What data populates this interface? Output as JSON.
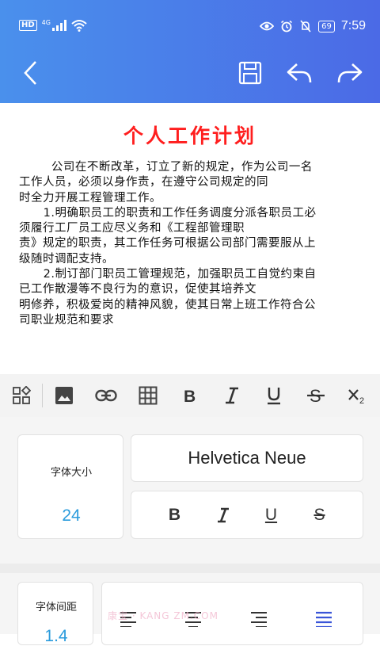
{
  "status_bar": {
    "network_badge": "HD",
    "network_type": "4G",
    "battery": "69",
    "time": "7:59"
  },
  "header": {
    "icons": [
      "back-icon",
      "save-icon",
      "undo-icon",
      "redo-icon"
    ]
  },
  "document": {
    "title": "个人工作计划",
    "title_color": "#ff1e1e",
    "body": "        公司在不断改革，订立了新的规定，作为公司一名\n工作人员，必须以身作责，在遵守公司规定的同\n时全力开展工程管理工作。\n      1.明确职员工的职责和工作任务调度分派各职员工必\n须履行工厂员工应尽义务和《工程部管理职\n责》规定的职责，其工作任务可根据公司部门需要服从上\n级随时调配支持。\n      2.制订部门职员工管理规范，加强职员工自觉约束自\n已工作散漫等不良行为的意识，促使其培养文\n明修养，积极爱岗的精神风貌，使其日常上班工作符合公\n司职业规范和要求"
  },
  "toolbar": {
    "items": [
      "blocks-icon",
      "image-icon",
      "link-icon",
      "table-icon",
      "bold-icon",
      "italic-icon",
      "underline-icon",
      "strikethrough-icon",
      "subscript-icon"
    ]
  },
  "font_panel": {
    "size_label": "字体大小",
    "size_value": "24",
    "font_name": "Helvetica Neue",
    "style_buttons": [
      "B",
      "I",
      "U",
      "S"
    ],
    "spacing_label": "字体间距",
    "spacing_value": "1.4",
    "accent_color": "#2a9bdc"
  },
  "watermark": "康宝 · KANG  ZM.COM"
}
